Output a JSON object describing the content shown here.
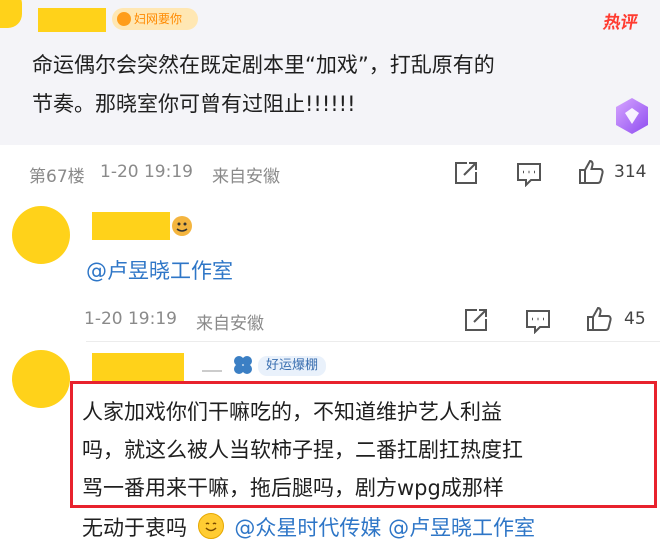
{
  "comment1": {
    "badge": "妇网要你",
    "hot_label": "热评",
    "text_line1": "命运偶尔会突然在既定剧本里“加戏”，打乱原有的",
    "text_line2": "节奏。那晓室你可曾有过阻止!!!!!!",
    "floor": "第67楼",
    "time": "1-20 19:19",
    "location": "来自安徽",
    "likes": "314"
  },
  "comment2": {
    "mention": "@卢昱晓工作室",
    "time": "1-20 19:19",
    "location": "来自安徽",
    "likes": "45"
  },
  "comment3": {
    "badge": "好运爆棚",
    "text_line1": "人家加戏你们干嘛吃的，不知道维护艺人利益",
    "text_line2": "吗，就这么被人当软柿子捏，二番扛剧扛热度扛",
    "text_line3": "骂一番用来干嘛，拖后腿吗，剧方wpg成那样",
    "text_line4_prefix": "无动于衷吗",
    "mention1": "@众星时代传媒",
    "mention2": "@卢昱晓工作室"
  },
  "colors": {
    "highlight_border": "#e8222d",
    "mention": "#2e76c7",
    "hot": "#ff3b30"
  }
}
